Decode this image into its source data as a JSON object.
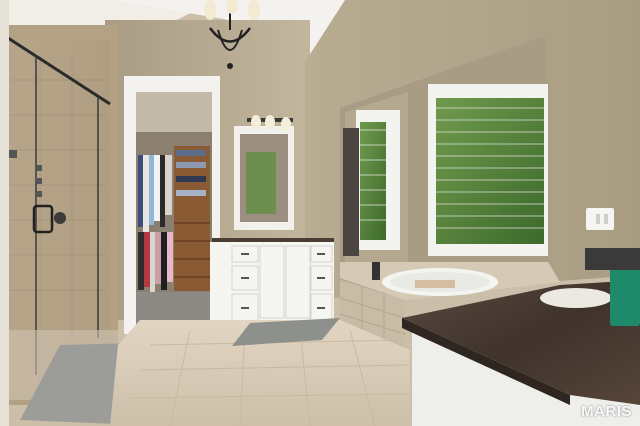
{
  "photo": {
    "description_colors": {
      "wall": "#b9ad94",
      "ceiling": "#f2efe9",
      "trim": "#f4f3ef",
      "floor": "#d9cbb6",
      "granite": "#4a3c34",
      "cabinet": "#f5f5f2",
      "foliage": "#4f7a38"
    }
  },
  "watermark": {
    "text": "MARIS"
  }
}
